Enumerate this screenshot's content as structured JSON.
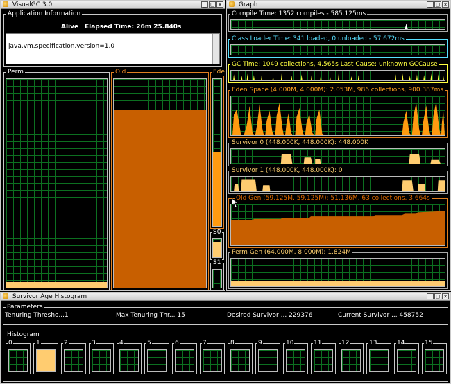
{
  "visualgc": {
    "title": "VisualGC 3.0",
    "app_info": {
      "label": "Application Information",
      "status": "Alive",
      "elapsed": "Elapsed Time:  26m 25.840s",
      "spec": "java.vm.specification.version=1.0"
    },
    "spaces": {
      "perm": "Perm",
      "old": "Old",
      "eden": "Ede",
      "s0": "S0",
      "s1": "S1"
    },
    "levels": {
      "perm": 0.03,
      "old": 0.97,
      "eden": 0.5,
      "s0": 0.9,
      "s1": 0.0
    }
  },
  "graph": {
    "title": "Graph",
    "panels": [
      {
        "label": "Compile Time: 1352 compiles - 585.125ms",
        "color": "#ffffff"
      },
      {
        "label": "Class Loader Time: 341 loaded, 0 unloaded - 57.672ms",
        "color": "#58e0ff"
      },
      {
        "label": "GC Time: 1049 collections, 4.565s  Last Cause: unknown GCCause",
        "color": "#ffff40"
      },
      {
        "label": "Eden Space (4.000M, 4.000M): 2.053M, 986 collections, 900.387ms",
        "color": "#ffa020"
      },
      {
        "label": "Survivor 0 (448.000K, 448.000K): 448.000K",
        "color": "#ffd070"
      },
      {
        "label": "Survivor 1 (448.000K, 448.000K): 0",
        "color": "#ffd070"
      },
      {
        "label": "Old Gen (59.125M, 59.125M): 51.136M, 63 collections, 3.664s",
        "color": "#e06a00"
      },
      {
        "label": "Perm Gen (64.000M, 8.000M): 1.824M",
        "color": "#ffd070"
      }
    ]
  },
  "histogram": {
    "title": "Survivor Age Histogram",
    "params_label": "Parameters",
    "params": [
      {
        "label": "Tenuring Thresho...",
        "value": "1"
      },
      {
        "label": "Max Tenuring Thr...",
        "value": "15"
      },
      {
        "label": "Desired Survivor ...",
        "value": "229376"
      },
      {
        "label": "Current Survivor ...",
        "value": "458752"
      }
    ],
    "hist_label": "Histogram",
    "bins": [
      "0",
      "1",
      "2",
      "3",
      "4",
      "5",
      "6",
      "7",
      "8",
      "9",
      "10",
      "11",
      "12",
      "13",
      "14",
      "15"
    ],
    "bin_levels": [
      0,
      1,
      0,
      0,
      0,
      0,
      0,
      0,
      0,
      0,
      0,
      0,
      0,
      0,
      0,
      0
    ]
  },
  "window_buttons": {
    "minimize": "_",
    "maximize": "□",
    "close": "×"
  },
  "colors": {
    "grid": "#0c6f20",
    "old": "#c85f00",
    "survivor": "#ffcc70",
    "eden": "#ff9a10"
  }
}
